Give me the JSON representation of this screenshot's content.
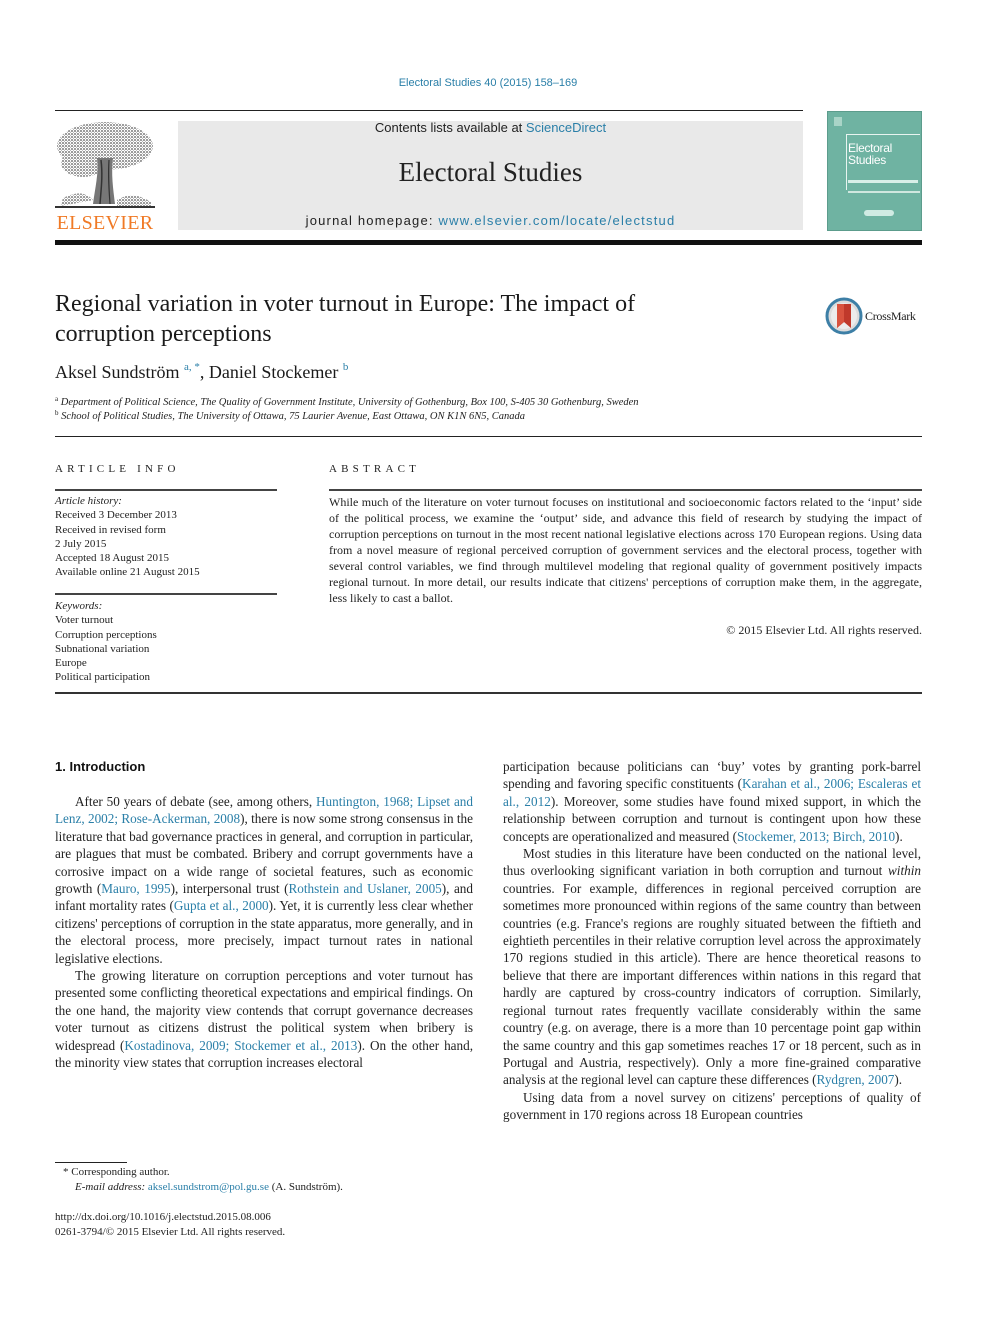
{
  "header": {
    "citation": "Electoral Studies 40 (2015) 158–169",
    "contents_prefix": "Contents lists available at ",
    "contents_link": "ScienceDirect",
    "journal_title": "Electoral Studies",
    "homepage_prefix": "journal homepage: ",
    "homepage_link": "www.elsevier.com/locate/electstud",
    "publisher_logo_text": "ELSEVIER",
    "cover": {
      "title_line1": "Electoral",
      "title_line2": "Studies",
      "color": "#6fb3a2"
    },
    "publisher_color": "#f07a26",
    "link_color": "#2a7fa8"
  },
  "article": {
    "title_line1": "Regional variation in voter turnout in Europe: The impact of",
    "title_line2": "corruption perceptions",
    "crossmark_label": "CrossMark",
    "authors": [
      {
        "name": "Aksel Sundström",
        "marks": "a, *"
      },
      {
        "name": "Daniel Stockemer",
        "marks": "b"
      }
    ],
    "author_separator": ", ",
    "affiliations": [
      {
        "mark": "a",
        "text": "Department of Political Science, The Quality of Government Institute, University of Gothenburg, Box 100, S-405 30 Gothenburg, Sweden"
      },
      {
        "mark": "b",
        "text": "School of Political Studies, The University of Ottawa, 75 Laurier Avenue, East Ottawa, ON K1N 6N5, Canada"
      }
    ]
  },
  "article_info": {
    "heading": "ARTICLE INFO",
    "history_label": "Article history:",
    "history": [
      "Received 3 December 2013",
      "Received in revised form",
      "2 July 2015",
      "Accepted 18 August 2015",
      "Available online 21 August 2015"
    ],
    "keywords_label": "Keywords:",
    "keywords": [
      "Voter turnout",
      "Corruption perceptions",
      "Subnational variation",
      "Europe",
      "Political participation"
    ]
  },
  "abstract": {
    "heading": "ABSTRACT",
    "text": "While much of the literature on voter turnout focuses on institutional and socioeconomic factors related to the ‘input’ side of the political process, we examine the ‘output’ side, and advance this field of research by studying the impact of corruption perceptions on turnout in the most recent national legislative elections across 170 European regions. Using data from a novel measure of regional perceived corruption of government services and the electoral process, together with several control variables, we find through multilevel modeling that regional quality of government positively impacts regional turnout. In more detail, our results indicate that citizens' perceptions of corruption make them, in the aggregate, less likely to cast a ballot.",
    "copyright": "© 2015 Elsevier Ltd. All rights reserved."
  },
  "body": {
    "section_heading": "1.  Introduction",
    "left_p1": [
      {
        "t": "After 50 years of debate (see, among others, "
      },
      {
        "t": "Huntington, 1968; Lipset and Lenz, 2002; Rose-Ackerman, 2008",
        "link": true
      },
      {
        "t": "), there is now some strong consensus in the literature that bad governance practices in general, and corruption in particular, are plagues that must be combated. Bribery and corrupt governments have a corrosive impact on a wide range of societal features, such as economic growth ("
      },
      {
        "t": "Mauro, 1995",
        "link": true
      },
      {
        "t": "), interpersonal trust ("
      },
      {
        "t": "Rothstein and Uslaner, 2005",
        "link": true
      },
      {
        "t": "), and infant mortality rates ("
      },
      {
        "t": "Gupta et al., 2000",
        "link": true
      },
      {
        "t": "). Yet, it is currently less clear whether citizens' perceptions of corruption in the state apparatus, more generally, and in the electoral process, more precisely, impact turnout rates in national legislative elections."
      }
    ],
    "left_p2": [
      {
        "t": "The growing literature on corruption perceptions and voter turnout has presented some conflicting theoretical expectations and empirical findings. On the one hand, the majority view contends that corrupt governance decreases voter turnout as citizens distrust the political system when bribery is widespread ("
      },
      {
        "t": "Kostadinova, 2009; Stockemer et al., 2013",
        "link": true
      },
      {
        "t": "). On the other hand, the minority view states that corruption increases electoral"
      }
    ],
    "right_p1": [
      {
        "t": "participation because politicians can ‘buy’ votes by granting pork-barrel spending and favoring specific constituents ("
      },
      {
        "t": "Karahan et al., 2006; Escaleras et al., 2012",
        "link": true
      },
      {
        "t": "). Moreover, some studies have found mixed support, in which the relationship between corruption and turnout is contingent upon how these concepts are operationalized and measured ("
      },
      {
        "t": "Stockemer, 2013; Birch, 2010",
        "link": true
      },
      {
        "t": ")."
      }
    ],
    "right_p2": [
      {
        "t": "Most studies in this literature have been conducted on the national level, thus overlooking significant variation in both corruption and turnout "
      },
      {
        "t": "within",
        "em": true
      },
      {
        "t": " countries. For example, differences in regional perceived corruption are sometimes more pronounced within regions of the same country than between countries (e.g. France's regions are roughly situated between the fiftieth and eightieth percentiles in their relative corruption level across the approximately 170 regions studied in this article). There are hence theoretical reasons to believe that there are important differences within nations in this regard that hardly are captured by cross-country indicators of corruption. Similarly, regional turnout rates frequently vacillate considerably within the same country (e.g. on average, there is a more than 10 percentage point gap within the same country and this gap sometimes reaches 17 or 18 percent, such as in Portugal and Austria, respectively). Only a more fine-grained comparative analysis at the regional level can capture these differences ("
      },
      {
        "t": "Rydgren, 2007",
        "link": true
      },
      {
        "t": ")."
      }
    ],
    "right_p3": [
      {
        "t": "Using data from a novel survey on citizens' perceptions of quality of government in 170 regions across 18 European countries"
      }
    ]
  },
  "footnotes": {
    "corresponding": "*  Corresponding author.",
    "email_label": "E-mail address: ",
    "email": "aksel.sundstrom@pol.gu.se",
    "email_suffix": " (A. Sundström).",
    "doi": "http://dx.doi.org/10.1016/j.electstud.2015.08.006",
    "issn": "0261-3794/© 2015 Elsevier Ltd. All rights reserved."
  }
}
